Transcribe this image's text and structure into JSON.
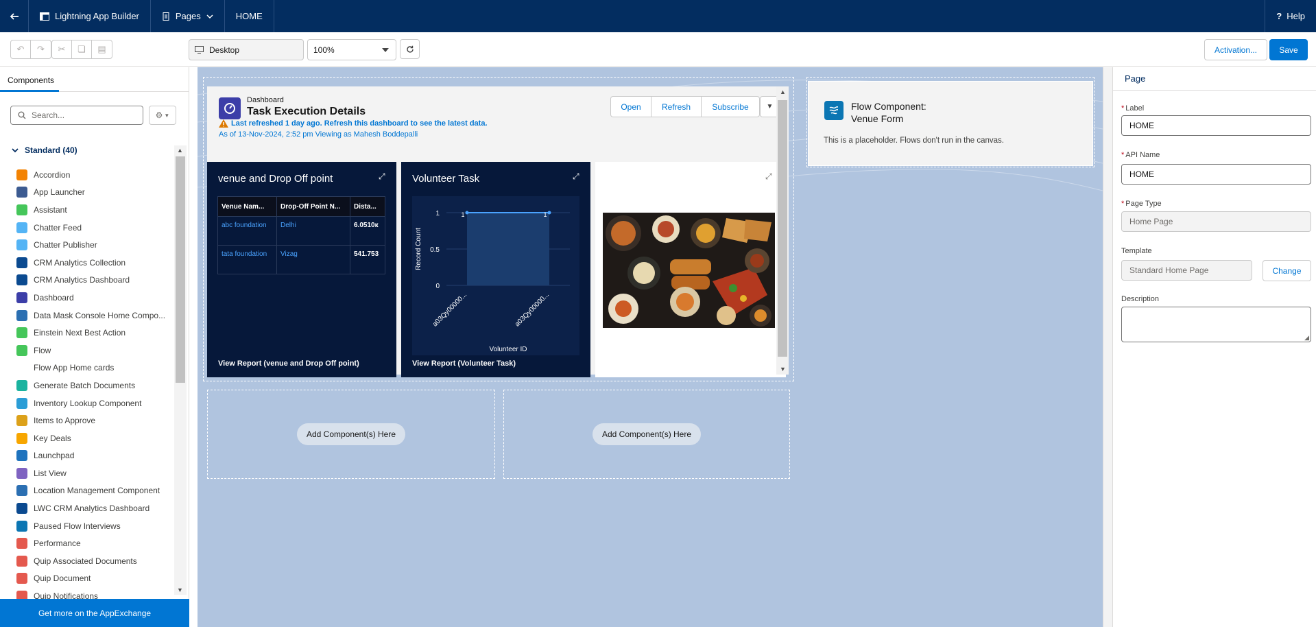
{
  "nav": {
    "app_name": "Lightning App Builder",
    "pages_label": "Pages",
    "page_name": "HOME",
    "help_label": "Help"
  },
  "toolbar": {
    "device_value": "Desktop",
    "zoom_value": "100%",
    "activation_label": "Activation...",
    "save_label": "Save"
  },
  "left_panel": {
    "tab_label": "Components",
    "search_placeholder": "Search...",
    "section_title": "Standard (40)",
    "items": [
      {
        "label": "Accordion",
        "icon": "accordion-icon",
        "color": "#f38303"
      },
      {
        "label": "App Launcher",
        "icon": "app-launcher-icon",
        "color": "#3c5b91"
      },
      {
        "label": "Assistant",
        "icon": "assistant-icon",
        "color": "#45c65a"
      },
      {
        "label": "Chatter Feed",
        "icon": "chatter-feed-icon",
        "color": "#54b4f5"
      },
      {
        "label": "Chatter Publisher",
        "icon": "chatter-publisher-icon",
        "color": "#54b4f5"
      },
      {
        "label": "CRM Analytics Collection",
        "icon": "analytics-icon",
        "color": "#0b4a90"
      },
      {
        "label": "CRM Analytics Dashboard",
        "icon": "analytics-icon",
        "color": "#0b4a90"
      },
      {
        "label": "Dashboard",
        "icon": "dashboard-icon",
        "color": "#3c3ea8"
      },
      {
        "label": "Data Mask Console Home Compo...",
        "icon": "data-mask-icon",
        "color": "#2b6fb2"
      },
      {
        "label": "Einstein Next Best Action",
        "icon": "einstein-icon",
        "color": "#45c65a"
      },
      {
        "label": "Flow",
        "icon": "flow-icon",
        "color": "#45c65a"
      },
      {
        "label": "Flow App Home cards",
        "icon": "",
        "color": ""
      },
      {
        "label": "Generate Batch Documents",
        "icon": "batch-documents-icon",
        "color": "#1ab39f"
      },
      {
        "label": "Inventory Lookup Component",
        "icon": "inventory-icon",
        "color": "#2b9dd6"
      },
      {
        "label": "Items to Approve",
        "icon": "approval-icon",
        "color": "#dca11a"
      },
      {
        "label": "Key Deals",
        "icon": "key-deals-icon",
        "color": "#f7a600"
      },
      {
        "label": "Launchpad",
        "icon": "launchpad-icon",
        "color": "#1e73be"
      },
      {
        "label": "List View",
        "icon": "list-view-icon",
        "color": "#7f63c1"
      },
      {
        "label": "Location Management Component",
        "icon": "location-icon",
        "color": "#2b6fb2"
      },
      {
        "label": "LWC CRM Analytics Dashboard",
        "icon": "analytics-icon",
        "color": "#0b4a90"
      },
      {
        "label": "Paused Flow Interviews",
        "icon": "paused-flow-icon",
        "color": "#0b76b3"
      },
      {
        "label": "Performance",
        "icon": "performance-icon",
        "color": "#e4594e"
      },
      {
        "label": "Quip Associated Documents",
        "icon": "quip-icon",
        "color": "#e4594e"
      },
      {
        "label": "Quip Document",
        "icon": "quip-icon",
        "color": "#e4594e"
      },
      {
        "label": "Quip Notifications",
        "icon": "quip-icon",
        "color": "#e4594e"
      }
    ],
    "appexchange_label": "Get more on the AppExchange"
  },
  "dashboard": {
    "label": "Dashboard",
    "title": "Task Execution Details",
    "warning": "Last refreshed 1 day ago. Refresh this dashboard to see the latest data.",
    "as_of": "As of 13-Nov-2024, 2:52 pm Viewing as Mahesh Boddepalli",
    "buttons": {
      "open": "Open",
      "refresh": "Refresh",
      "subscribe": "Subscribe"
    },
    "widget1": {
      "title": "venue and Drop Off point",
      "columns": [
        "Venue Nam...",
        "Drop-Off Point N...",
        "Dista..."
      ],
      "rows": [
        [
          "abc foundation",
          "Delhi",
          "6.0510к"
        ],
        [
          "tata foundation",
          "Vizag",
          "541.753"
        ]
      ],
      "footer": "View Report (venue and Drop Off point)"
    },
    "widget2": {
      "title": "Volunteer Task",
      "footer": "View Report (Volunteer Task)"
    }
  },
  "chart_data": {
    "type": "line",
    "categories": [
      "a03Qy00000...",
      "a03Qy00000..."
    ],
    "series": [
      {
        "values": [
          1,
          1
        ]
      }
    ],
    "data_labels": [
      "1",
      "1"
    ],
    "xlabel": "Volunteer ID",
    "ylabel": "Record Count",
    "y_ticks": [
      "0",
      "0.5",
      "1"
    ],
    "ylim": [
      0,
      1
    ],
    "colors": {
      "line": "#4aa3ff",
      "area": "#1b3d6e"
    }
  },
  "canvas": {
    "add_label_left": "Add Component(s) Here",
    "add_label_right": "Add Component(s) Here"
  },
  "flow": {
    "title_line1": "Flow Component:",
    "title_line2": "Venue Form",
    "note": "This is a placeholder. Flows don't run in the canvas."
  },
  "right_panel": {
    "header": "Page",
    "label_label": "Label",
    "label_value": "HOME",
    "api_label": "API Name",
    "api_value": "HOME",
    "type_label": "Page Type",
    "type_value": "Home Page",
    "template_label": "Template",
    "template_value": "Standard Home Page",
    "change_label": "Change",
    "description_label": "Description"
  }
}
